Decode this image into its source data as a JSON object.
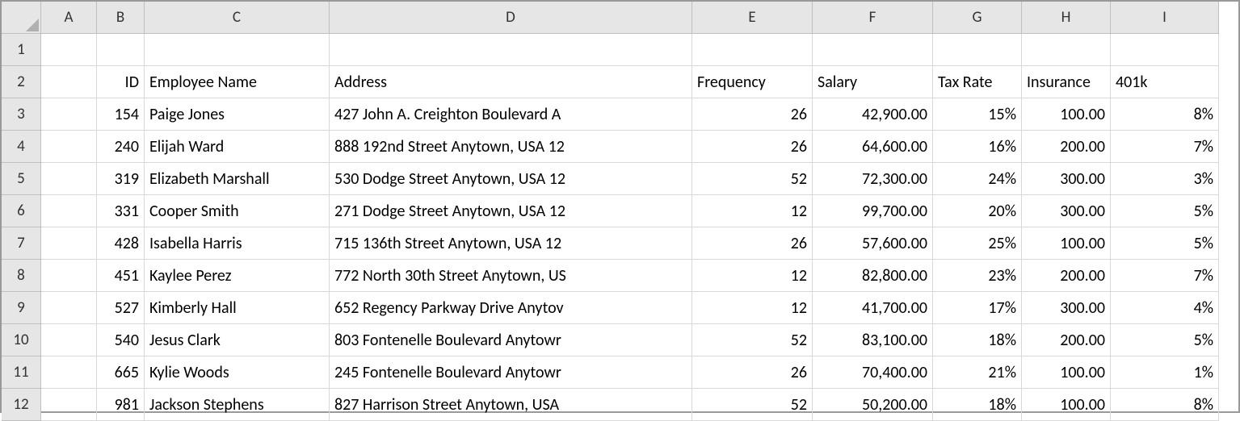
{
  "columns": [
    "A",
    "B",
    "C",
    "D",
    "E",
    "F",
    "G",
    "H",
    "I"
  ],
  "rows": [
    "1",
    "2",
    "3",
    "4",
    "5",
    "6",
    "7",
    "8",
    "9",
    "10",
    "11",
    "12"
  ],
  "headers": {
    "B": "ID",
    "C": "Employee Name",
    "D": "Address",
    "E": "Frequency",
    "F": "Salary",
    "G": "Tax Rate",
    "H": "Insurance",
    "I": "401k"
  },
  "data": [
    {
      "id": "154",
      "name": "Paige Jones",
      "address": "427 John A. Creighton Boulevard A",
      "freq": "26",
      "salary": "42,900.00",
      "tax": "15%",
      "ins": "100.00",
      "k": "8%"
    },
    {
      "id": "240",
      "name": "Elijah Ward",
      "address": "888 192nd Street Anytown, USA 12",
      "freq": "26",
      "salary": "64,600.00",
      "tax": "16%",
      "ins": "200.00",
      "k": "7%"
    },
    {
      "id": "319",
      "name": "Elizabeth Marshall",
      "address": "530 Dodge Street Anytown, USA 12",
      "freq": "52",
      "salary": "72,300.00",
      "tax": "24%",
      "ins": "300.00",
      "k": "3%"
    },
    {
      "id": "331",
      "name": "Cooper Smith",
      "address": "271 Dodge Street Anytown, USA 12",
      "freq": "12",
      "salary": "99,700.00",
      "tax": "20%",
      "ins": "300.00",
      "k": "5%"
    },
    {
      "id": "428",
      "name": "Isabella Harris",
      "address": "715 136th Street Anytown, USA 12",
      "freq": "26",
      "salary": "57,600.00",
      "tax": "25%",
      "ins": "100.00",
      "k": "5%"
    },
    {
      "id": "451",
      "name": "Kaylee Perez",
      "address": "772 North 30th Street Anytown, US",
      "freq": "12",
      "salary": "82,800.00",
      "tax": "23%",
      "ins": "200.00",
      "k": "7%"
    },
    {
      "id": "527",
      "name": "Kimberly Hall",
      "address": "652 Regency Parkway Drive Anytov",
      "freq": "12",
      "salary": "41,700.00",
      "tax": "17%",
      "ins": "300.00",
      "k": "4%"
    },
    {
      "id": "540",
      "name": "Jesus Clark",
      "address": "803 Fontenelle Boulevard Anytowr",
      "freq": "52",
      "salary": "83,100.00",
      "tax": "18%",
      "ins": "200.00",
      "k": "5%"
    },
    {
      "id": "665",
      "name": "Kylie Woods",
      "address": "245 Fontenelle Boulevard Anytowr",
      "freq": "26",
      "salary": "70,400.00",
      "tax": "21%",
      "ins": "100.00",
      "k": "1%"
    },
    {
      "id": "981",
      "name": "Jackson Stephens",
      "address": "827 Harrison Street Anytown, USA",
      "freq": "52",
      "salary": "50,200.00",
      "tax": "18%",
      "ins": "100.00",
      "k": "8%"
    }
  ]
}
